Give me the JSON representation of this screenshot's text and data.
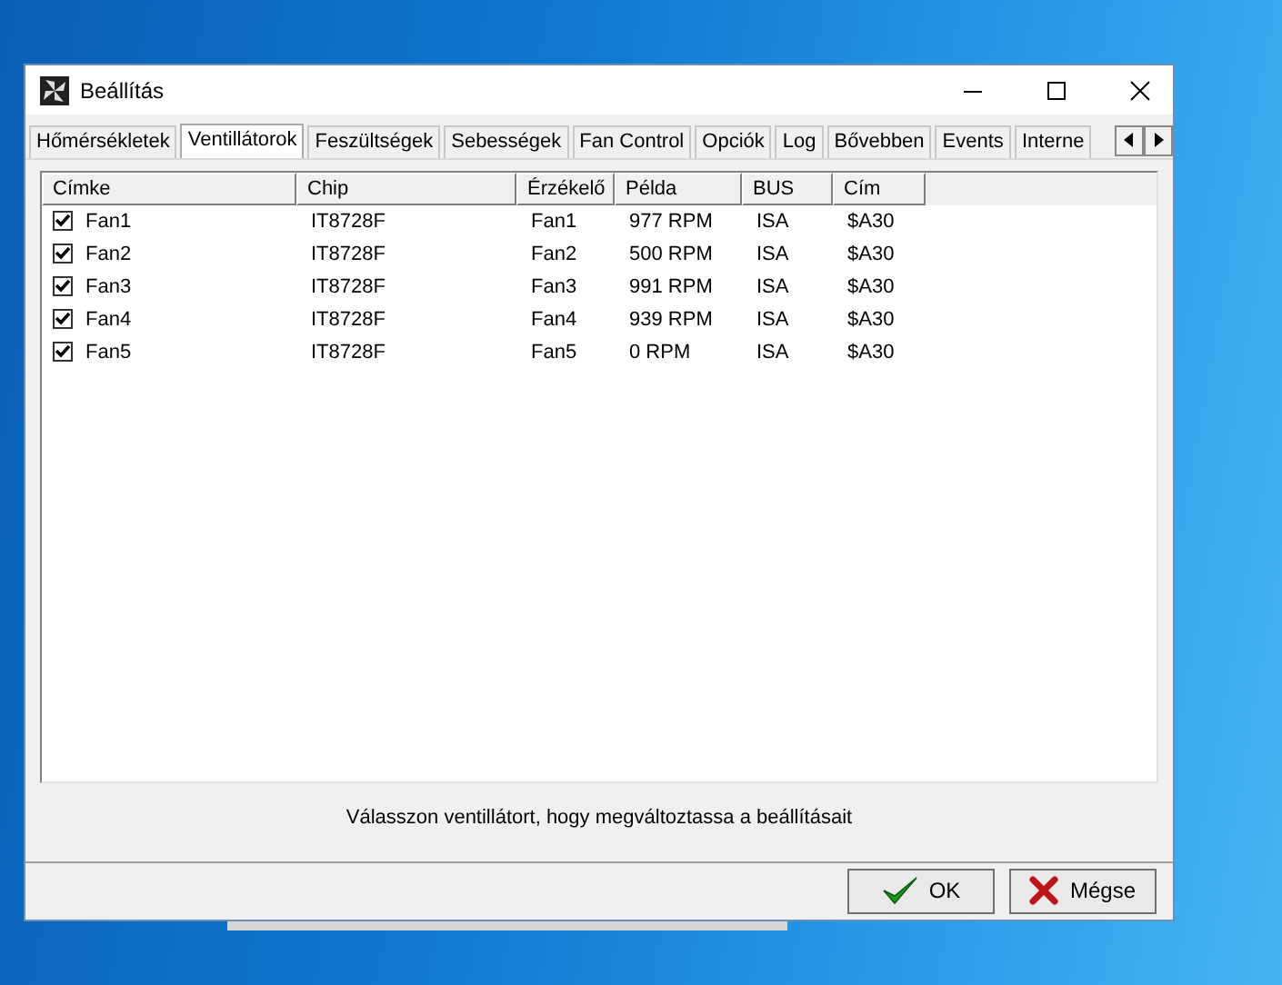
{
  "window": {
    "title": "Beállítás"
  },
  "tabs": [
    {
      "label": "Hőmérsékletek",
      "selected": false
    },
    {
      "label": "Ventillátorok",
      "selected": true
    },
    {
      "label": "Feszültségek",
      "selected": false
    },
    {
      "label": "Sebességek",
      "selected": false
    },
    {
      "label": "Fan Control",
      "selected": false
    },
    {
      "label": "Opciók",
      "selected": false
    },
    {
      "label": "Log",
      "selected": false
    },
    {
      "label": "Bővebben",
      "selected": false
    },
    {
      "label": "Events",
      "selected": false
    },
    {
      "label": "Interne",
      "selected": false
    }
  ],
  "table": {
    "columns": [
      "Címke",
      "Chip",
      "Érzékelő",
      "Példa",
      "BUS",
      "Cím"
    ],
    "rows": [
      {
        "checked": true,
        "cells": [
          "Fan1",
          "IT8728F",
          "Fan1",
          "977 RPM",
          "ISA",
          "$A30"
        ]
      },
      {
        "checked": true,
        "cells": [
          "Fan2",
          "IT8728F",
          "Fan2",
          "500 RPM",
          "ISA",
          "$A30"
        ]
      },
      {
        "checked": true,
        "cells": [
          "Fan3",
          "IT8728F",
          "Fan3",
          "991 RPM",
          "ISA",
          "$A30"
        ]
      },
      {
        "checked": true,
        "cells": [
          "Fan4",
          "IT8728F",
          "Fan4",
          "939 RPM",
          "ISA",
          "$A30"
        ]
      },
      {
        "checked": true,
        "cells": [
          "Fan5",
          "IT8728F",
          "Fan5",
          "0 RPM",
          "ISA",
          "$A30"
        ]
      }
    ]
  },
  "status_text": "Válasszon ventillátort, hogy megváltoztassa a beállításait",
  "buttons": [
    {
      "kind": "ok",
      "label": "OK"
    },
    {
      "kind": "cancel",
      "label": "Mégse"
    }
  ]
}
